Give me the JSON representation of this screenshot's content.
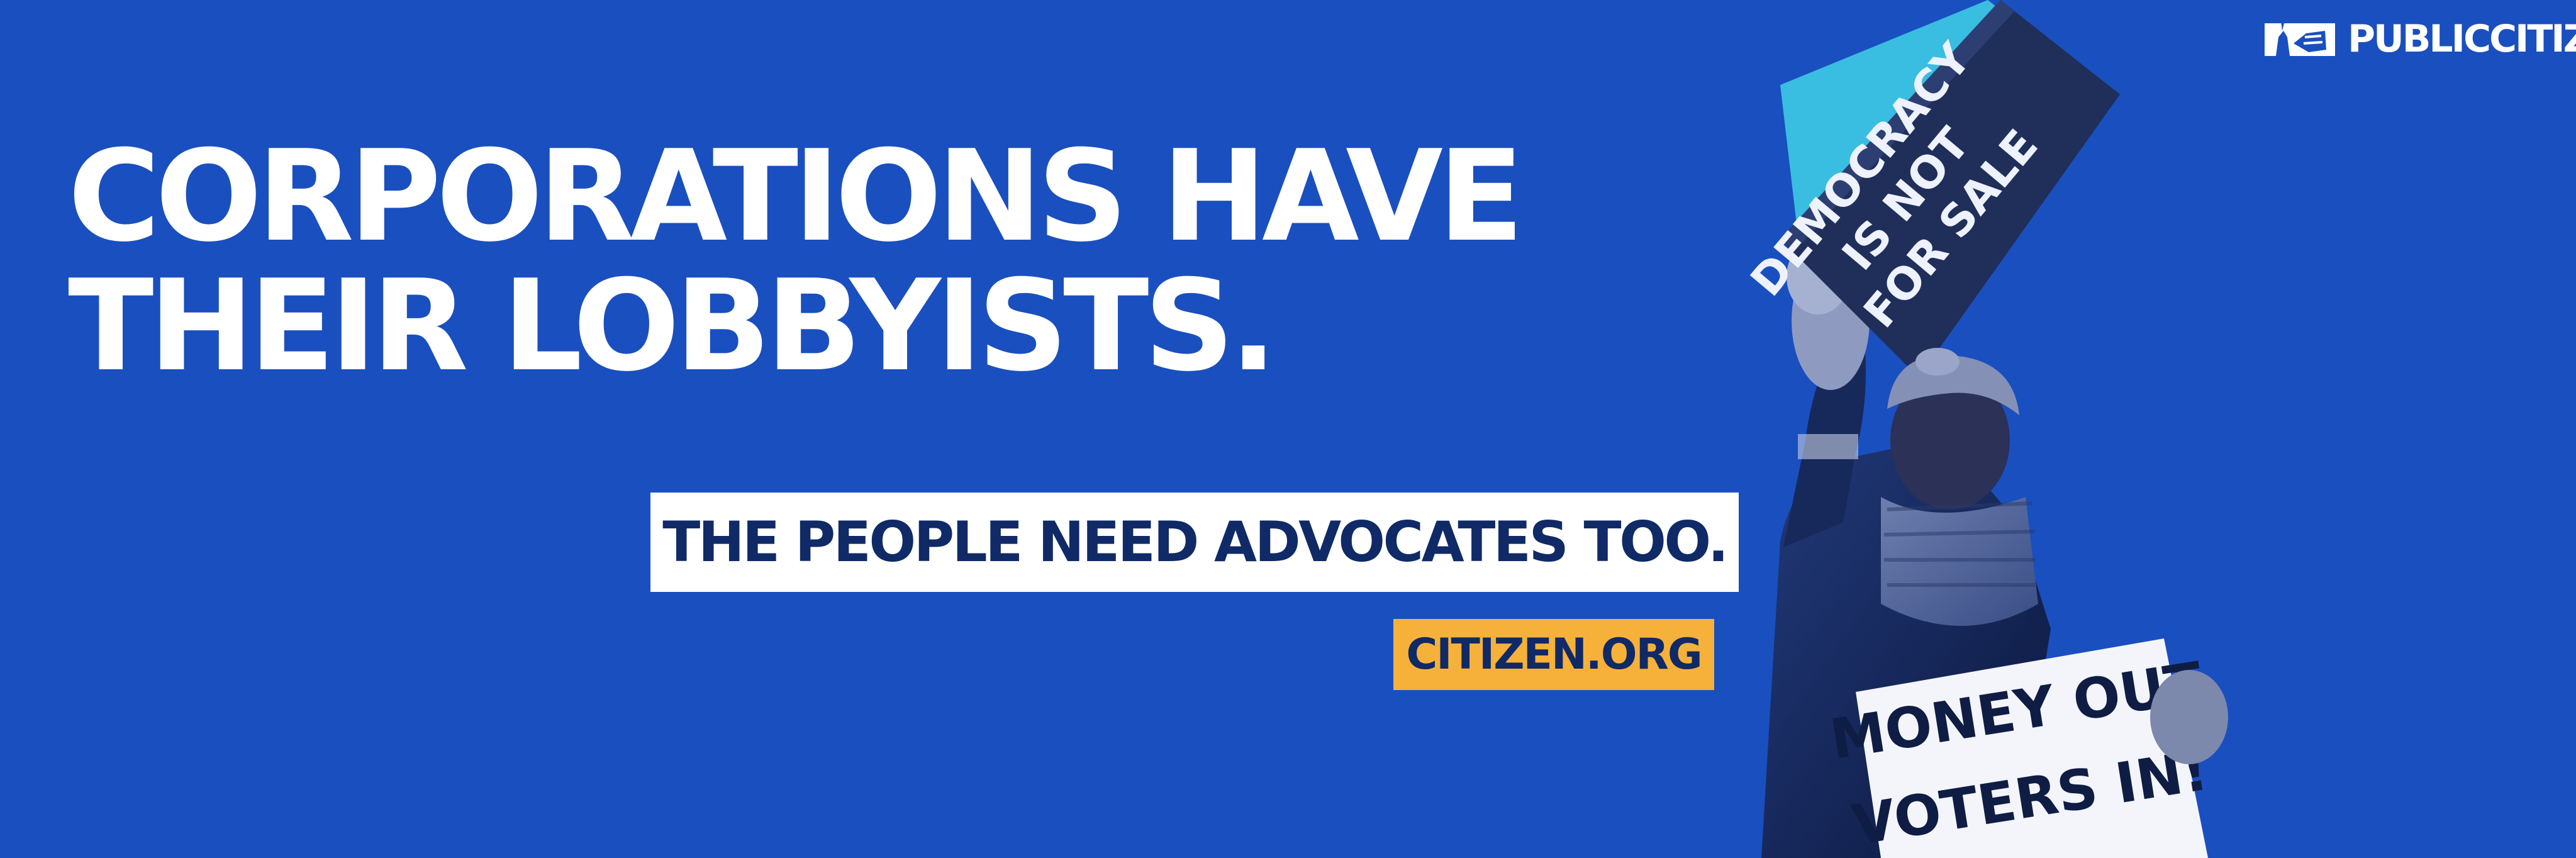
{
  "headline": {
    "line1": "CORPORATIONS HAVE",
    "line2": "THEIR LOBBYISTS."
  },
  "subline": "THE PEOPLE NEED ADVOCATES TOO.",
  "url": "CITIZEN.ORG",
  "brand": {
    "name": "PUBLICCITIZEN",
    "icon": "statue-of-liberty-logo-icon"
  },
  "photo": {
    "sign_top": [
      "DEMOCRACY",
      "IS NOT",
      "FOR SALE"
    ],
    "sign_bottom": [
      "MONEY OUT",
      "VOTERS IN!"
    ]
  },
  "colors": {
    "background": "#1a4fbf",
    "headline": "#ffffff",
    "subline_bg": "#ffffff",
    "dark_text": "#0f2a66",
    "url_bg": "#f6b13b"
  }
}
